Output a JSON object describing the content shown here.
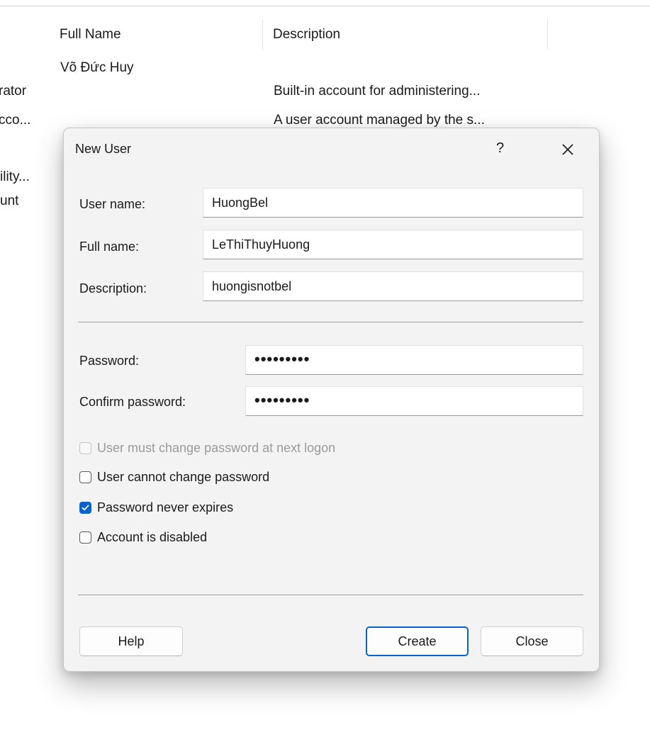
{
  "list": {
    "columns": [
      "Full Name",
      "Description"
    ],
    "rows": [
      {
        "name_partial": "",
        "full_name": "Võ Đức Huy",
        "description": ""
      },
      {
        "name_partial": "rator",
        "full_name": "",
        "description": "Built-in account for administering..."
      },
      {
        "name_partial": "cco...",
        "full_name": "",
        "description": "A user account managed by the s..."
      },
      {
        "name_partial": "ility...",
        "full_name": "",
        "description": ""
      },
      {
        "name_partial": "unt",
        "full_name": "",
        "description": ""
      }
    ]
  },
  "dialog": {
    "title": "New User",
    "help_glyph": "?",
    "close_glyph": "✕",
    "fields": {
      "user_name": {
        "label": "User name:",
        "value": "HuongBel"
      },
      "full_name": {
        "label": "Full name:",
        "value": "LeThiThuyHuong"
      },
      "description": {
        "label": "Description:",
        "value": "huongisnotbel"
      },
      "password": {
        "label": "Password:",
        "value": "•••••••••"
      },
      "confirm_password": {
        "label": "Confirm password:",
        "value": "•••••••••"
      }
    },
    "options": [
      {
        "label": "User must change password at next logon",
        "checked": false,
        "disabled": true
      },
      {
        "label": "User cannot change password",
        "checked": false,
        "disabled": false
      },
      {
        "label": "Password never expires",
        "checked": true,
        "disabled": false
      },
      {
        "label": "Account is disabled",
        "checked": false,
        "disabled": false
      }
    ],
    "buttons": {
      "help": "Help",
      "create": "Create",
      "close": "Close"
    }
  },
  "colors": {
    "accent": "#0a63c9",
    "dialog_bg": "#f3f3f3",
    "disabled_text": "#9b9b9b"
  }
}
